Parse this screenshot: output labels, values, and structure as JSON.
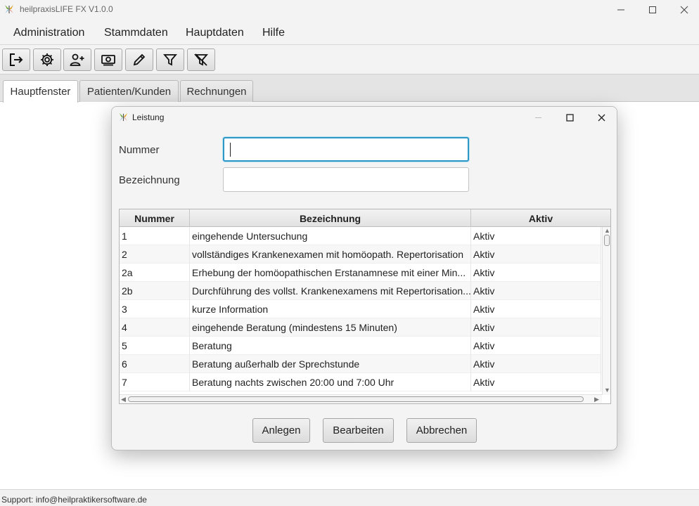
{
  "app": {
    "title": "heilpraxisLIFE FX V1.0.0",
    "icon": "butterfly-logo-icon"
  },
  "window_controls": {
    "minimize": "minimize-icon",
    "maximize": "maximize-icon",
    "close": "close-icon"
  },
  "menu": {
    "items": [
      "Administration",
      "Stammdaten",
      "Hauptdaten",
      "Hilfe"
    ]
  },
  "toolbar": {
    "buttons": [
      "logout-icon",
      "settings-gear-icon",
      "add-user-icon",
      "money-icon",
      "edit-pencil-icon",
      "filter-icon",
      "clear-filter-icon"
    ]
  },
  "tabs": [
    {
      "label": "Hauptfenster",
      "active": true
    },
    {
      "label": "Patienten/Kunden",
      "active": false
    },
    {
      "label": "Rechnungen",
      "active": false
    }
  ],
  "status": {
    "text": "Support: info@heilpraktikersoftware.de"
  },
  "dialog": {
    "title": "Leistung",
    "fields": {
      "nummer_label": "Nummer",
      "nummer_value": "",
      "bezeichnung_label": "Bezeichnung",
      "bezeichnung_value": ""
    },
    "table": {
      "columns": [
        "Nummer",
        "Bezeichnung",
        "Aktiv"
      ],
      "rows": [
        [
          "1",
          "eingehende Untersuchung",
          "Aktiv"
        ],
        [
          "2",
          "vollständiges Krankenexamen mit homöopath. Repertorisation",
          "Aktiv"
        ],
        [
          "2a",
          "Erhebung der homöopathischen Erstanamnese mit einer Min...",
          "Aktiv"
        ],
        [
          "2b",
          "Durchführung des vollst. Krankenexamens mit Repertorisation...",
          "Aktiv"
        ],
        [
          "3",
          "kurze Information",
          "Aktiv"
        ],
        [
          "4",
          "eingehende Beratung (mindestens 15 Minuten)",
          "Aktiv"
        ],
        [
          "5",
          "Beratung",
          "Aktiv"
        ],
        [
          "6",
          "Beratung außerhalb der Sprechstunde",
          "Aktiv"
        ],
        [
          "7",
          "Beratung nachts zwischen 20:00 und 7:00 Uhr",
          "Aktiv"
        ]
      ]
    },
    "buttons": {
      "anlegen": "Anlegen",
      "bearbeiten": "Bearbeiten",
      "abbrechen": "Abbrechen"
    }
  },
  "colors": {
    "focus_border": "#2d98c7",
    "chrome": "#f3f3f3",
    "tab_bar": "#e4e4e4"
  }
}
